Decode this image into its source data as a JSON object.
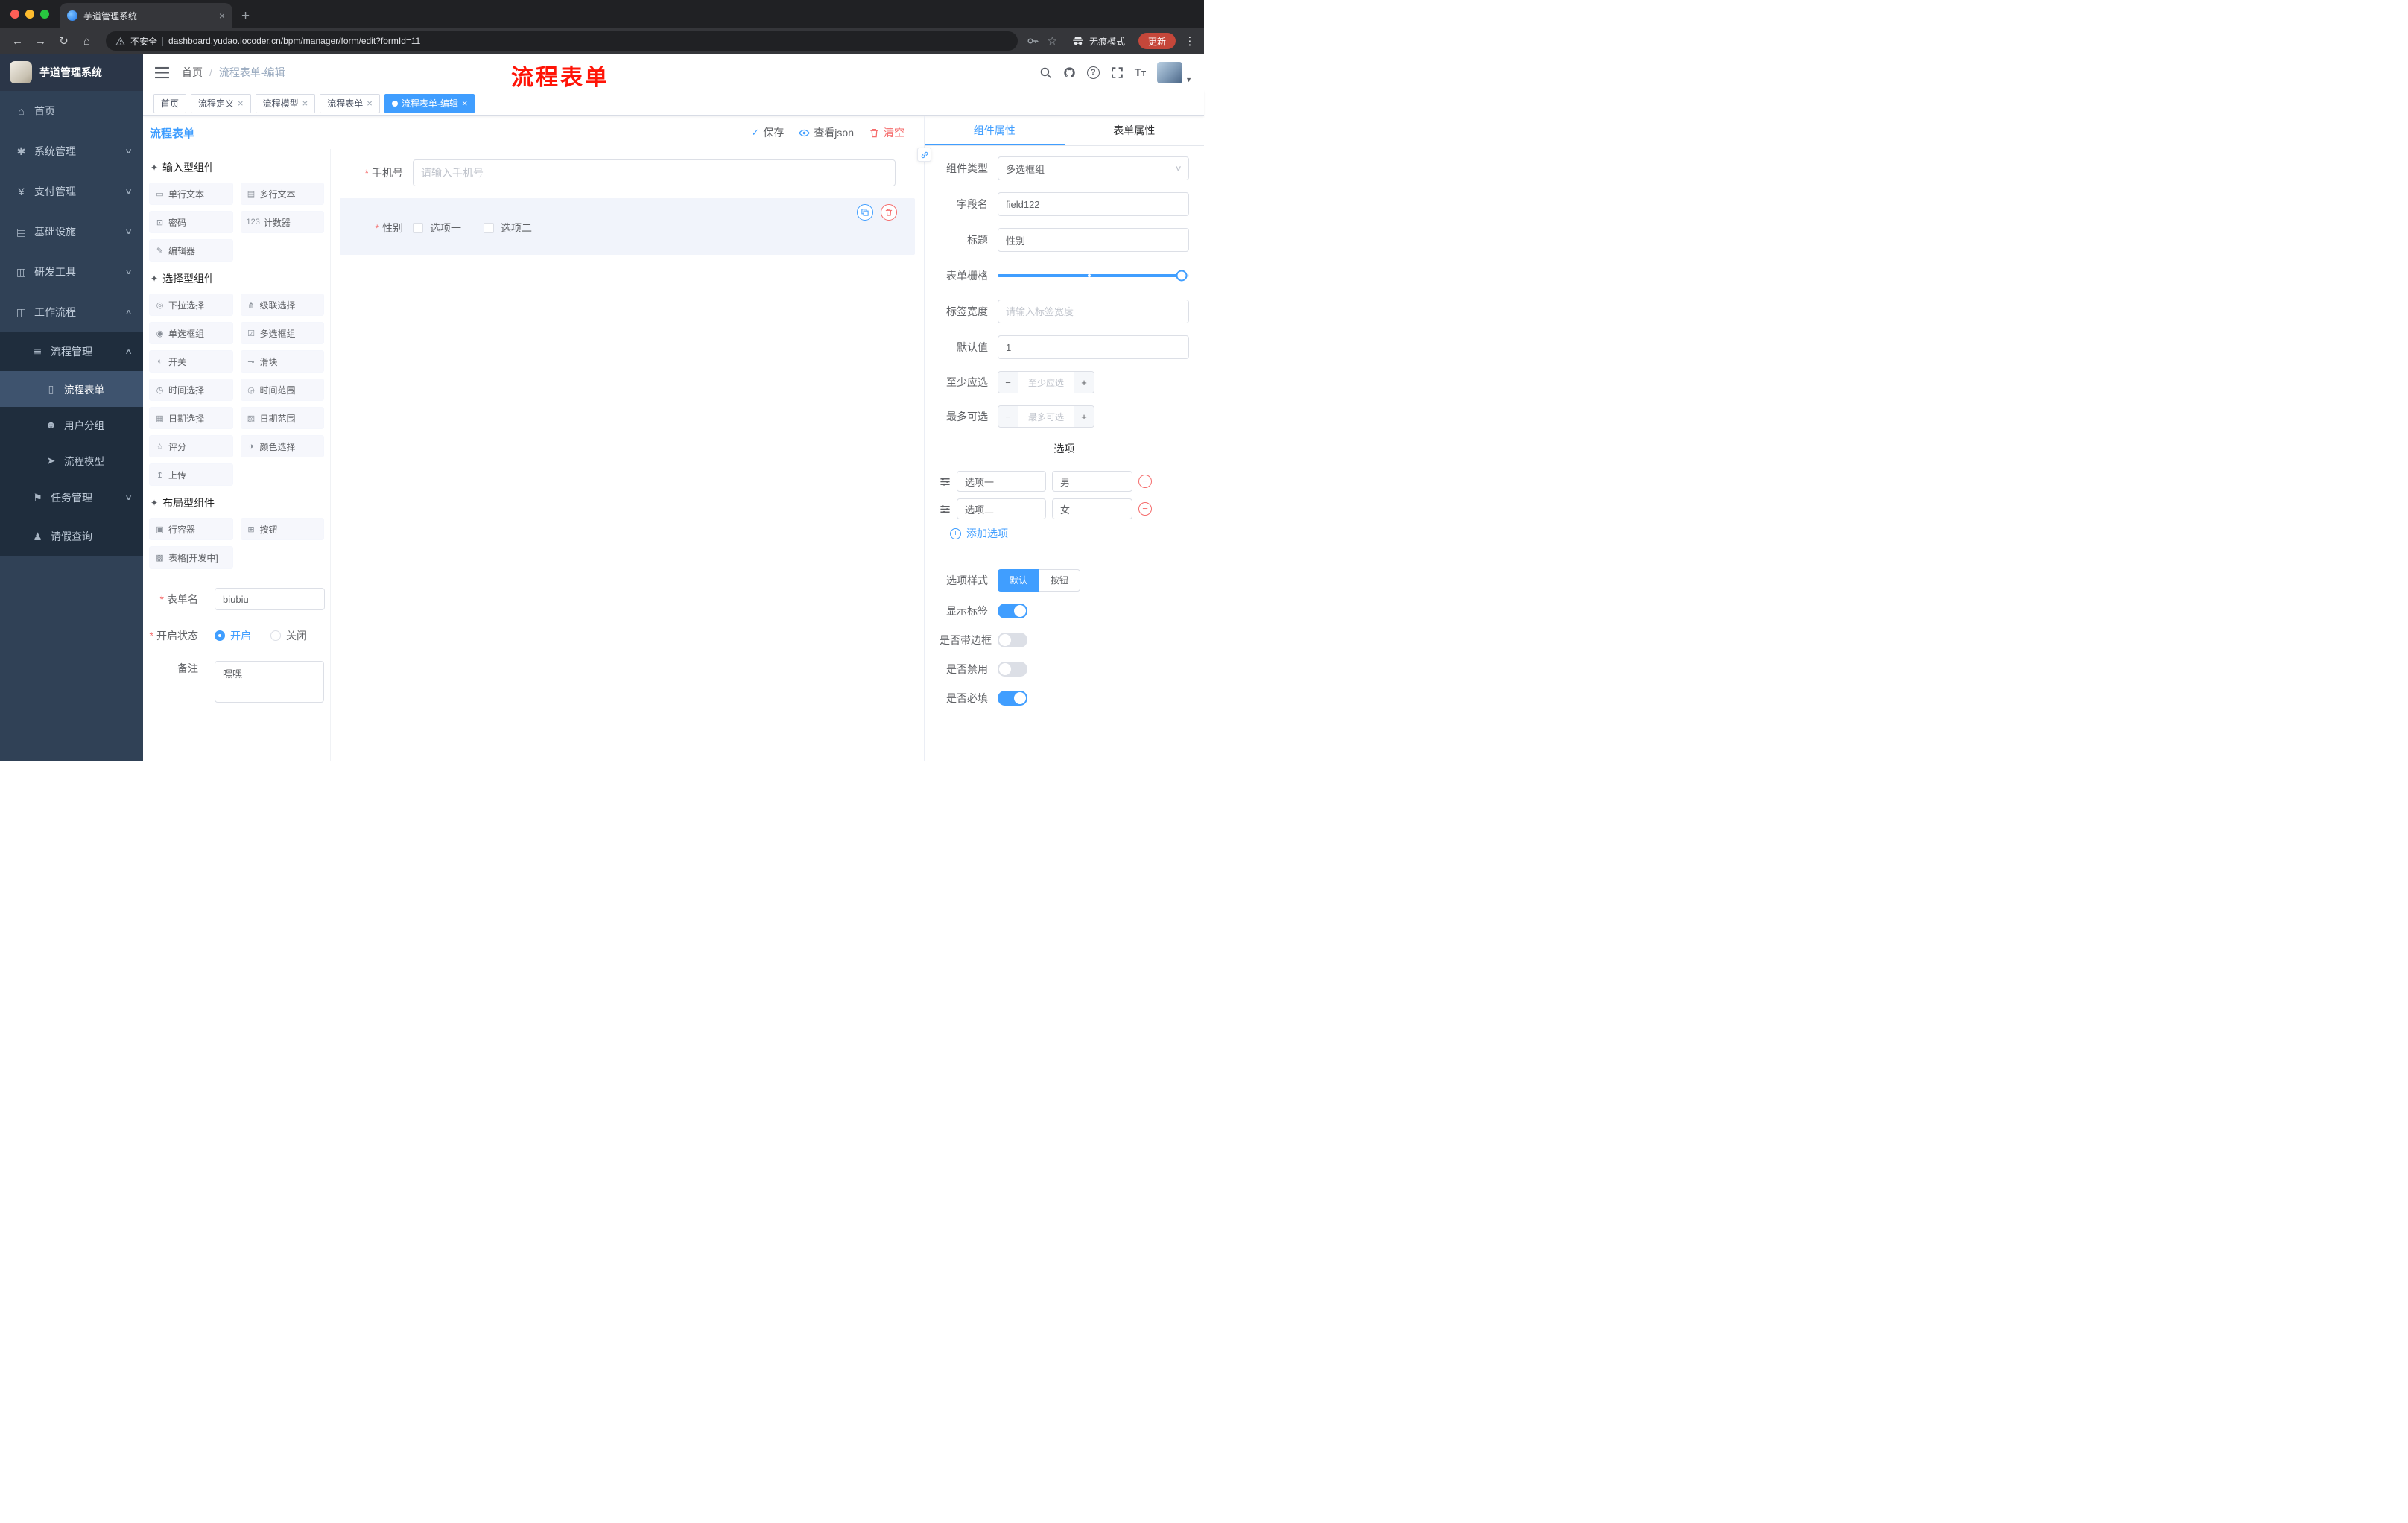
{
  "browser": {
    "tab_title": "芋道管理系统",
    "security_label": "不安全",
    "url": "dashboard.yudao.iocoder.cn/bpm/manager/form/edit?formId=11",
    "incognito_label": "无痕模式",
    "update_label": "更新"
  },
  "app_header": {
    "breadcrumb_home": "首页",
    "breadcrumb_separator": "/",
    "breadcrumb_current": "流程表单-编辑",
    "annotation": "流程表单",
    "annotation_color": "#ff1407"
  },
  "sidebar": {
    "logo_title": "芋道管理系统",
    "items": [
      {
        "label": "首页",
        "icon": "dashboard-icon"
      },
      {
        "label": "系统管理",
        "icon": "system-icon"
      },
      {
        "label": "支付管理",
        "icon": "payment-icon"
      },
      {
        "label": "基础设施",
        "icon": "infrastructure-icon"
      },
      {
        "label": "研发工具",
        "icon": "devtools-icon"
      },
      {
        "label": "工作流程",
        "icon": "workflow-icon"
      },
      {
        "label": "流程管理",
        "icon": "process-management-icon"
      },
      {
        "label": "流程表单",
        "icon": "process-form-icon"
      },
      {
        "label": "用户分组",
        "icon": "user-group-icon"
      },
      {
        "label": "流程模型",
        "icon": "process-model-icon"
      },
      {
        "label": "任务管理",
        "icon": "task-management-icon"
      },
      {
        "label": "请假查询",
        "icon": "leave-query-icon"
      }
    ]
  },
  "tags_view": [
    {
      "label": "首页",
      "closable": false,
      "active": false
    },
    {
      "label": "流程定义",
      "closable": true,
      "active": false
    },
    {
      "label": "流程模型",
      "closable": true,
      "active": false
    },
    {
      "label": "流程表单",
      "closable": true,
      "active": false
    },
    {
      "label": "流程表单-编辑",
      "closable": true,
      "active": true
    }
  ],
  "designer": {
    "title": "流程表单",
    "save_label": "保存",
    "view_json_label": "查看json",
    "clear_label": "清空"
  },
  "palette": {
    "groups": [
      {
        "title": "输入型组件",
        "icon": "group-icon",
        "items": [
          {
            "label": "单行文本",
            "icon": "single-line-text-icon"
          },
          {
            "label": "多行文本",
            "icon": "multi-line-text-icon"
          },
          {
            "label": "密码",
            "icon": "password-icon"
          },
          {
            "label": "计数器",
            "icon": "counter-icon"
          },
          {
            "label": "编辑器",
            "icon": "editor-icon"
          }
        ]
      },
      {
        "title": "选择型组件",
        "icon": "group-icon",
        "items": [
          {
            "label": "下拉选择",
            "icon": "select-icon"
          },
          {
            "label": "级联选择",
            "icon": "cascader-icon"
          },
          {
            "label": "单选框组",
            "icon": "radio-group-icon"
          },
          {
            "label": "多选框组",
            "icon": "checkbox-group-icon"
          },
          {
            "label": "开关",
            "icon": "switch-icon"
          },
          {
            "label": "滑块",
            "icon": "slider-icon"
          },
          {
            "label": "时间选择",
            "icon": "time-picker-icon"
          },
          {
            "label": "时间范围",
            "icon": "time-range-icon"
          },
          {
            "label": "日期选择",
            "icon": "date-picker-icon"
          },
          {
            "label": "日期范围",
            "icon": "date-range-icon"
          },
          {
            "label": "评分",
            "icon": "rate-icon"
          },
          {
            "label": "颜色选择",
            "icon": "color-picker-icon"
          },
          {
            "label": "上传",
            "icon": "upload-icon"
          }
        ]
      },
      {
        "title": "布局型组件",
        "icon": "group-icon",
        "items": [
          {
            "label": "行容器",
            "icon": "row-container-icon"
          },
          {
            "label": "按钮",
            "icon": "button-icon"
          },
          {
            "label": "表格[开发中]",
            "icon": "table-icon"
          }
        ]
      }
    ]
  },
  "form_meta": {
    "name_label": "表单名",
    "name_value": "biubiu",
    "status_label": "开启状态",
    "status_on": "开启",
    "status_off": "关闭",
    "status_value": "开启",
    "remark_label": "备注",
    "remark_value": "嘿嘿"
  },
  "canvas": {
    "phone_label": "手机号",
    "phone_placeholder": "请输入手机号",
    "gender_label": "性别",
    "gender_options": [
      "选项一",
      "选项二"
    ]
  },
  "props": {
    "tab_component": "组件属性",
    "tab_form": "表单属性",
    "component_type_label": "组件类型",
    "component_type_value": "多选框组",
    "field_name_label": "字段名",
    "field_name_value": "field122",
    "title_label": "标题",
    "title_value": "性别",
    "grid_label": "表单栅格",
    "grid_value_percent": 96,
    "label_width_label": "标签宽度",
    "label_width_placeholder": "请输入标签宽度",
    "default_label": "默认值",
    "default_value": "1",
    "min_label": "至少应选",
    "min_placeholder": "至少应选",
    "max_label": "最多可选",
    "max_placeholder": "最多可选",
    "divider_text": "选项",
    "options": [
      {
        "name": "选项一",
        "value": "男"
      },
      {
        "name": "选项二",
        "value": "女"
      }
    ],
    "add_option_label": "添加选项",
    "option_style_label": "选项样式",
    "option_style_default": "默认",
    "option_style_button": "按钮",
    "option_style_active": "默认",
    "toggles": [
      {
        "label": "显示标签",
        "on": true
      },
      {
        "label": "是否带边框",
        "on": false
      },
      {
        "label": "是否禁用",
        "on": false
      },
      {
        "label": "是否必填",
        "on": true
      }
    ],
    "accent_color": "#409eff"
  }
}
